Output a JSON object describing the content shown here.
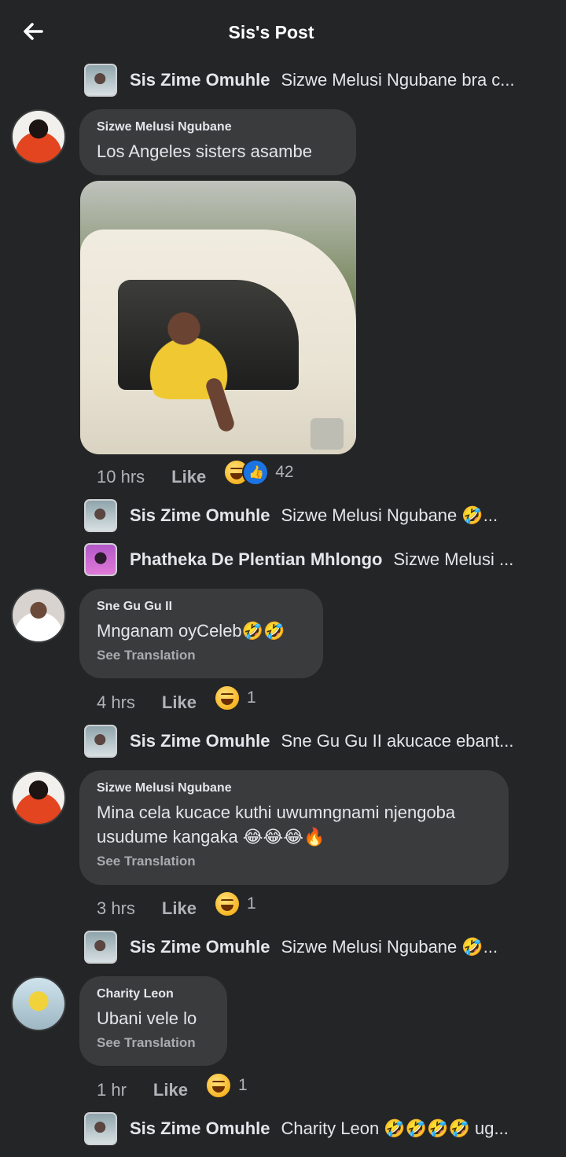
{
  "header": {
    "title": "Sis's Post"
  },
  "replies_top": {
    "name": "Sis Zime Omuhle",
    "text": "Sizwe Melusi Ngubane bra c..."
  },
  "comments": [
    {
      "author": "Sizwe Melusi Ngubane",
      "text": "Los Angeles sisters  asambe",
      "time": "10 hrs",
      "like": "Like",
      "reaction_count": "42",
      "replies": [
        {
          "name": "Sis Zime Omuhle",
          "text": "Sizwe Melusi Ngubane 🤣..."
        },
        {
          "name": "Phatheka De Plentian Mhlongo",
          "text": "Sizwe Melusi ..."
        }
      ]
    },
    {
      "author": "Sne Gu Gu II",
      "text": "Mnganam oyCeleb🤣🤣",
      "translate": "See Translation",
      "time": "4 hrs",
      "like": "Like",
      "reaction_count": "1",
      "replies": [
        {
          "name": "Sis Zime Omuhle",
          "text": "Sne Gu Gu II akucace ebant..."
        }
      ]
    },
    {
      "author": "Sizwe Melusi Ngubane",
      "text": "Mina cela kucace kuthi uwumngnami njengoba usudume kangaka 😂😂😂🔥",
      "translate": "See Translation",
      "time": "3 hrs",
      "like": "Like",
      "reaction_count": "1",
      "replies": [
        {
          "name": "Sis Zime Omuhle",
          "text": "Sizwe Melusi Ngubane 🤣..."
        }
      ]
    },
    {
      "author": "Charity Leon",
      "text": "Ubani vele lo",
      "translate": "See Translation",
      "time": "1 hr",
      "like": "Like",
      "reaction_count": "1",
      "replies": [
        {
          "name": "Sis Zime Omuhle",
          "text": "Charity Leon 🤣🤣🤣🤣 ug..."
        }
      ]
    }
  ],
  "icons": {
    "back": "arrow-left-icon",
    "haha": "haha-reaction-icon",
    "like": "like-reaction-icon"
  }
}
